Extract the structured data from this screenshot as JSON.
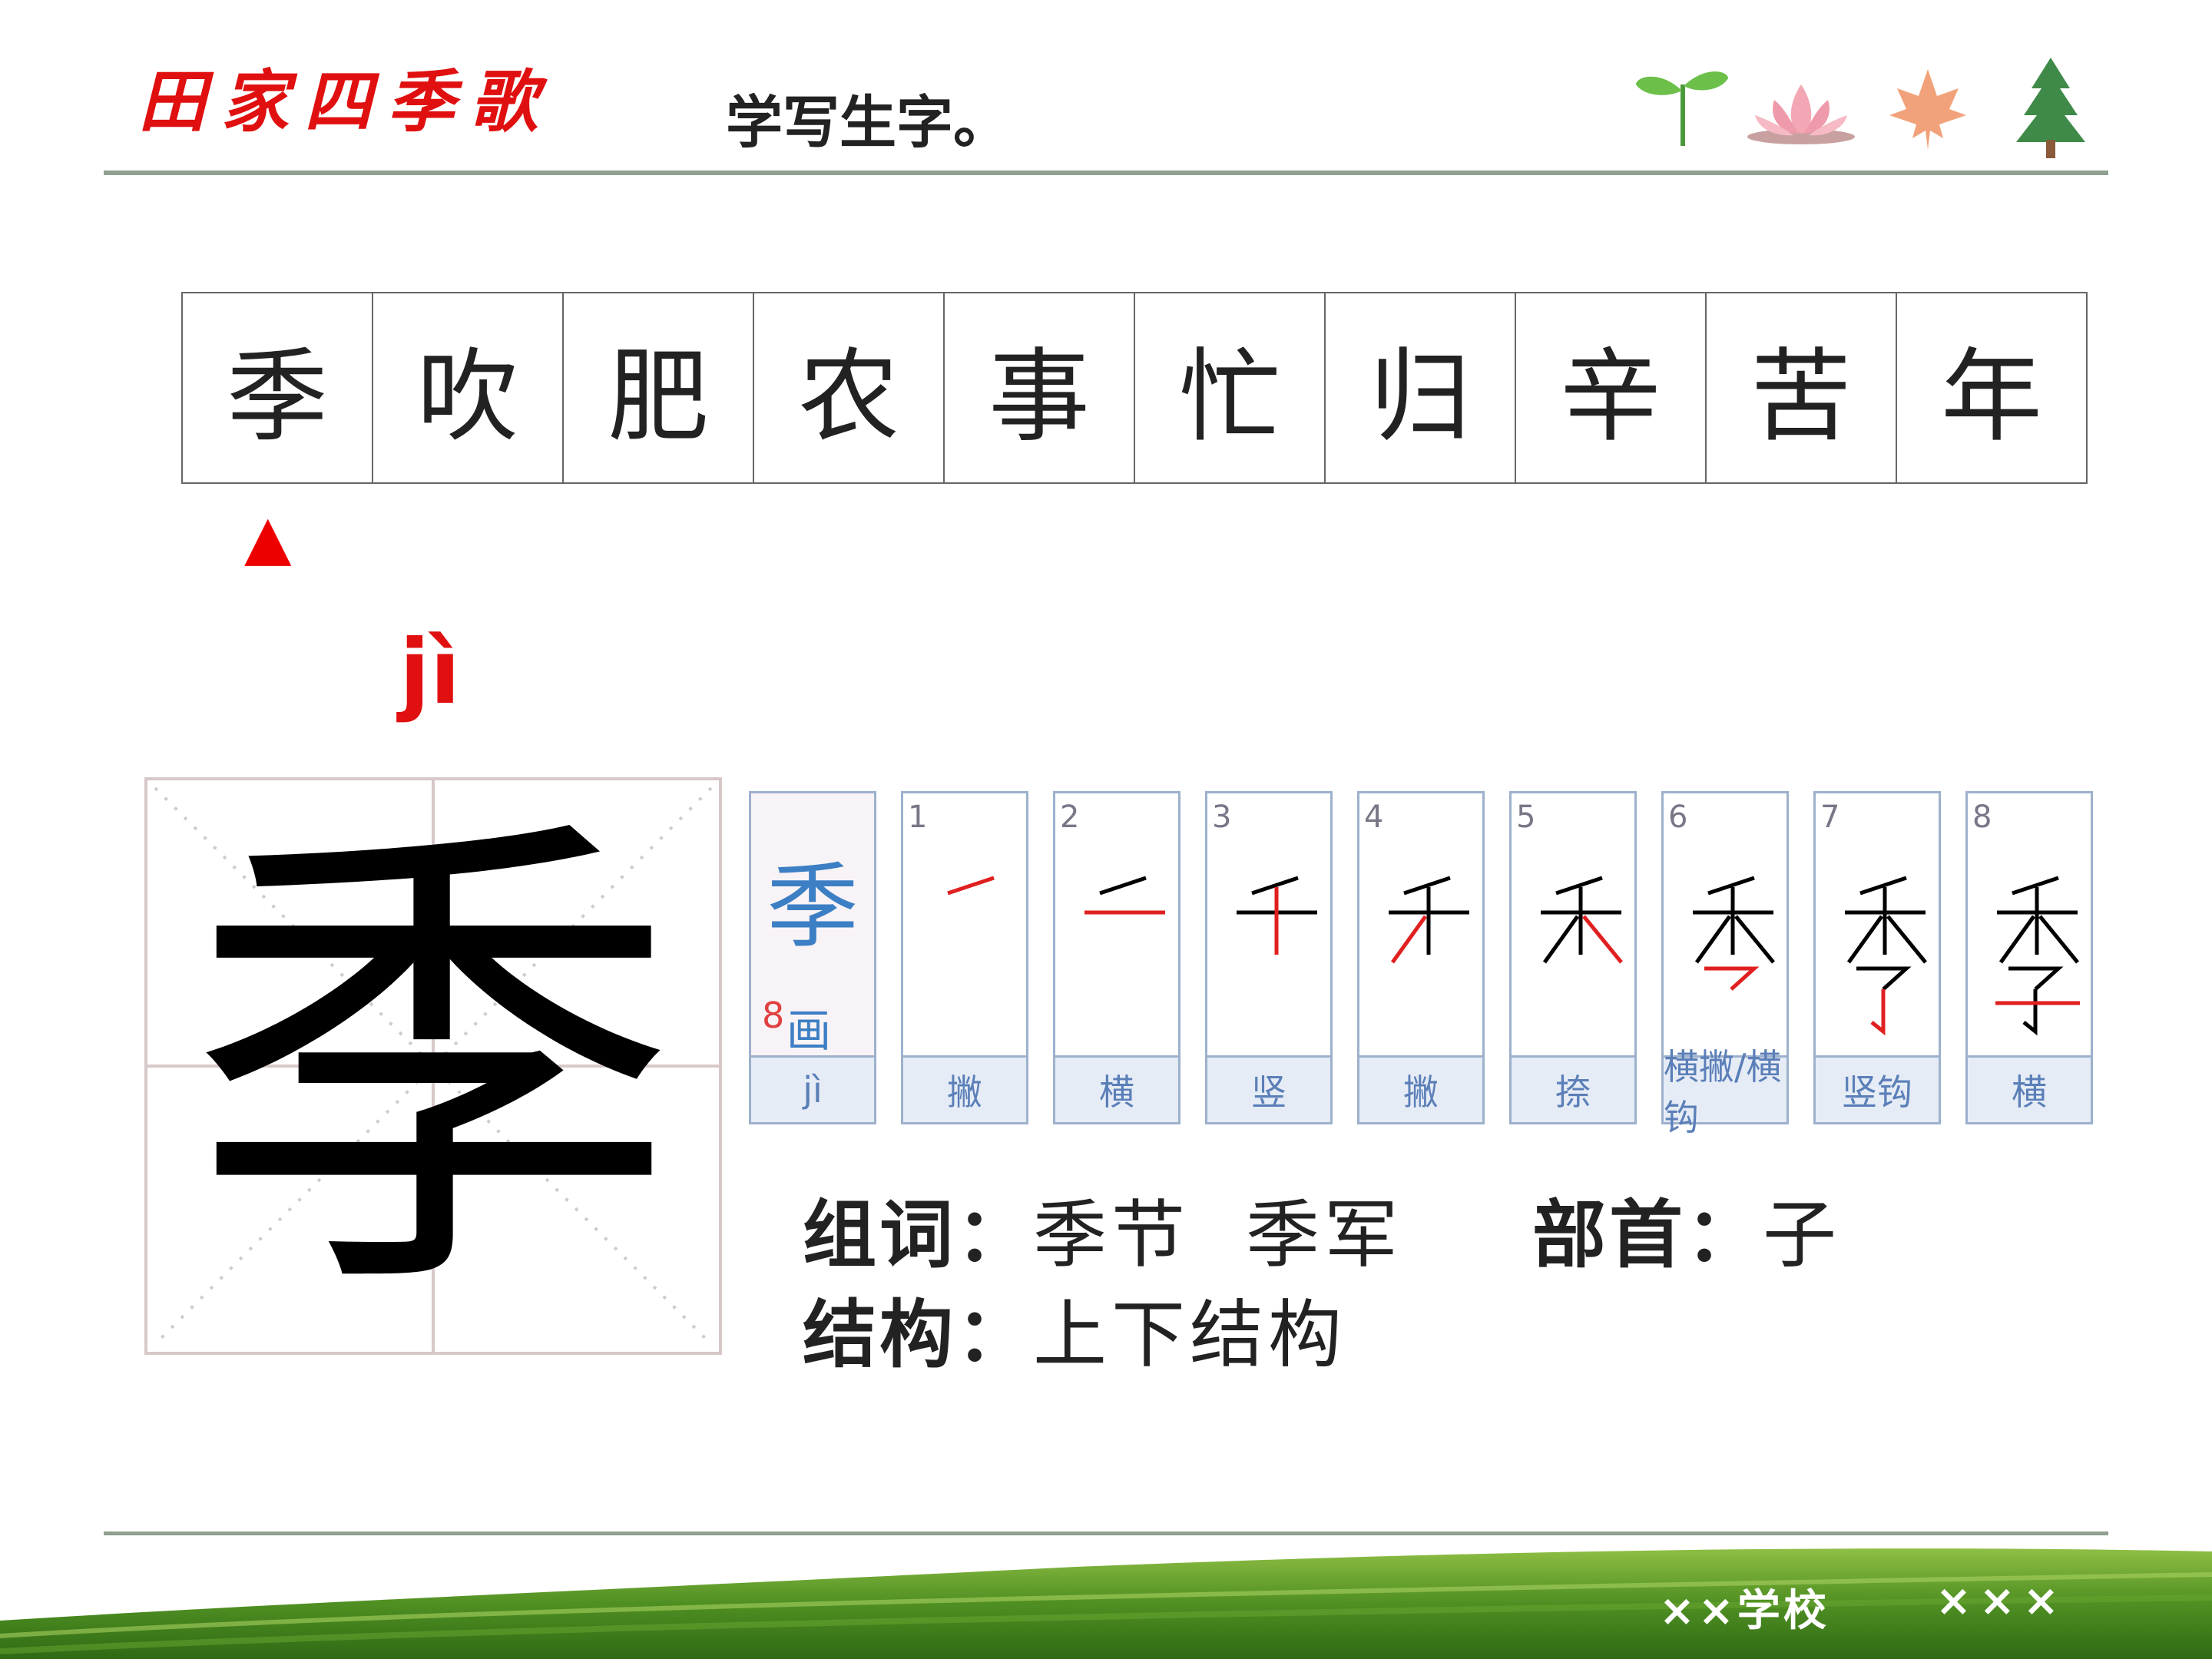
{
  "header": {
    "title": "田家四季歌",
    "subtitle": "学写生字。",
    "icons": [
      "sprout-icon",
      "lotus-icon",
      "maple-leaf-icon",
      "pine-tree-icon"
    ]
  },
  "characters": [
    "季",
    "吹",
    "肥",
    "农",
    "事",
    "忙",
    "归",
    "辛",
    "苦",
    "年"
  ],
  "selected_marker": "▲",
  "current": {
    "pinyin": "jì",
    "character": "季"
  },
  "stroke_card_summary": {
    "character": "季",
    "count": "8",
    "total_label": "画",
    "pinyin": "jì"
  },
  "strokes": [
    {
      "num": "1",
      "name": "撇"
    },
    {
      "num": "2",
      "name": "横"
    },
    {
      "num": "3",
      "name": "竖"
    },
    {
      "num": "4",
      "name": "撇"
    },
    {
      "num": "5",
      "name": "捺"
    },
    {
      "num": "6",
      "name": "横撇/横钩"
    },
    {
      "num": "7",
      "name": "竖钩"
    },
    {
      "num": "8",
      "name": "横"
    }
  ],
  "info": {
    "words_label": "组词：",
    "words": "季节  季军",
    "radical_label": "部首：",
    "radical": "子",
    "structure_label": "结构：",
    "structure": "上下结构"
  },
  "footer": {
    "school": "××学校",
    "suffix": "×××"
  },
  "colors": {
    "title_red": "#e01010",
    "rule_gray_green": "#8fa08f",
    "stroke_red": "#e02020",
    "card_blue": "#9db1cc"
  }
}
